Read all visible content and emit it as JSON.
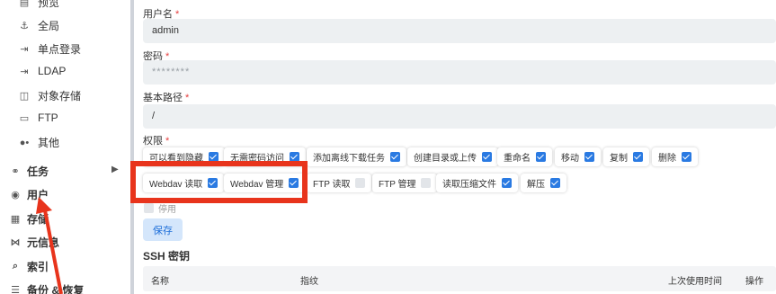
{
  "sidebar": {
    "items": [
      {
        "label": "预览",
        "icon": "preview-icon"
      },
      {
        "label": "全局",
        "icon": "anchor-icon"
      },
      {
        "label": "单点登录",
        "icon": "sso-icon"
      },
      {
        "label": "LDAP",
        "icon": "ldap-icon"
      },
      {
        "label": "对象存储",
        "icon": "bucket-icon"
      },
      {
        "label": "FTP",
        "icon": "ftp-icon"
      },
      {
        "label": "其他",
        "icon": "dots-icon"
      },
      {
        "label": "任务",
        "icon": "tasks-icon"
      },
      {
        "label": "用户",
        "icon": "user-icon"
      },
      {
        "label": "存储",
        "icon": "storage-icon"
      },
      {
        "label": "元信息",
        "icon": "meta-icon"
      },
      {
        "label": "索引",
        "icon": "search-icon"
      },
      {
        "label": "备份 & 恢复",
        "icon": "database-icon"
      }
    ]
  },
  "form": {
    "username_label": "用户名",
    "username_value": "admin",
    "password_label": "密码",
    "password_value": "********",
    "basepath_label": "基本路径",
    "basepath_value": "/",
    "permissions_label": "权限",
    "required_mark": "*",
    "permissions": [
      {
        "label": "可以看到隐藏",
        "checked": true
      },
      {
        "label": "无需密码访问",
        "checked": true
      },
      {
        "label": "添加离线下载任务",
        "checked": true
      },
      {
        "label": "创建目录或上传",
        "checked": true
      },
      {
        "label": "重命名",
        "checked": true
      },
      {
        "label": "移动",
        "checked": true
      },
      {
        "label": "复制",
        "checked": true
      },
      {
        "label": "删除",
        "checked": true
      },
      {
        "label": "Webdav 读取",
        "checked": true
      },
      {
        "label": "Webdav 管理",
        "checked": true
      },
      {
        "label": "FTP 读取",
        "checked": false
      },
      {
        "label": "FTP 管理",
        "checked": false
      },
      {
        "label": "读取压缩文件",
        "checked": true
      },
      {
        "label": "解压",
        "checked": true
      }
    ],
    "disable_label": "停用",
    "save_label": "保存"
  },
  "ssh": {
    "title": "SSH 密钥",
    "columns": [
      "名称",
      "指纹",
      "上次使用时间",
      "操作"
    ]
  },
  "colors": {
    "accent": "#2a7ae2",
    "annotation": "#e8341c",
    "required": "#e53e3e"
  }
}
